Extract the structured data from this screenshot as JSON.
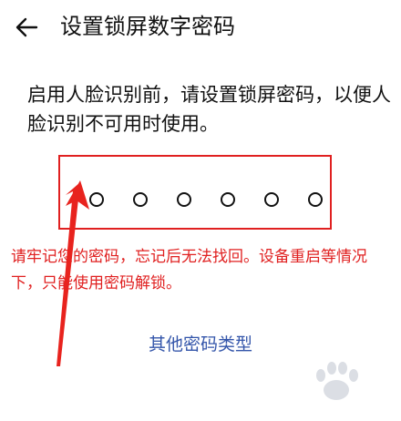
{
  "header": {
    "back_icon": "arrow-left-icon",
    "title": "设置锁屏数字密码"
  },
  "intro_text": "启用人脸识别前，请设置锁屏密码，以便人脸识别不可用时使用。",
  "pin": {
    "length": 6,
    "entered": 0
  },
  "warning_text": "请牢记您的密码，忘记后无法找回。设备重启等情况下，只能使用密码解锁。",
  "other_password_link": "其他密码类型",
  "colors": {
    "annotation_red": "#e02020",
    "link_blue": "#3355aa"
  }
}
